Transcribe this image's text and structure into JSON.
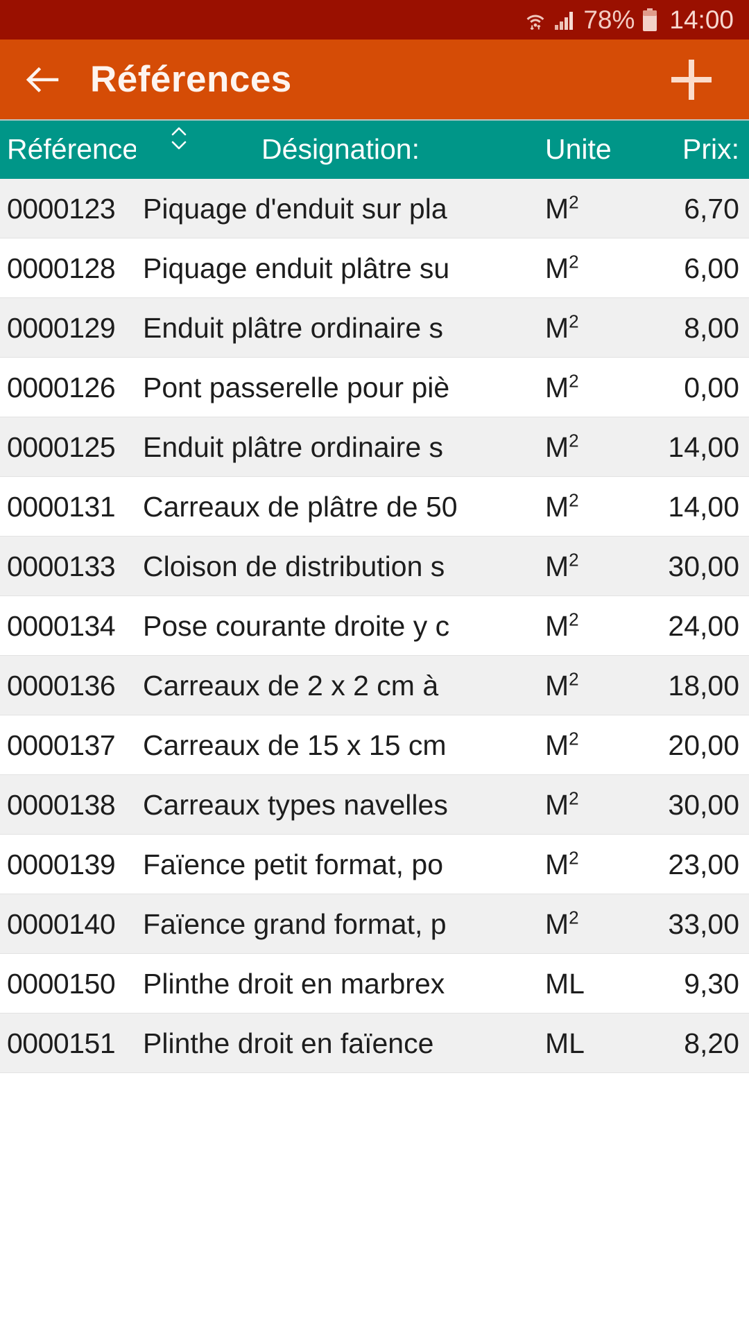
{
  "status_bar": {
    "battery_percent": "78%",
    "clock": "14:00",
    "icons": [
      "wifi-icon",
      "signal-icon",
      "battery-icon"
    ],
    "background_color": "#9a1000"
  },
  "app_bar": {
    "back_icon": "back-arrow-icon",
    "title": "Références",
    "add_icon": "plus-icon",
    "background_color": "#d54c06"
  },
  "table": {
    "header_color": "#009688",
    "sort_indicator_icon": "sort-updown-icon",
    "columns": [
      {
        "key": "reference",
        "label": "Référence:"
      },
      {
        "key": "designation",
        "label": "Désignation:"
      },
      {
        "key": "unite",
        "label": "Unite"
      },
      {
        "key": "prix",
        "label": "Prix:"
      }
    ],
    "rows": [
      {
        "reference": "0000123",
        "designation": "Piquage d'enduit sur pla",
        "unite": "M²",
        "prix": "6,70"
      },
      {
        "reference": "0000128",
        "designation": "Piquage enduit plâtre su",
        "unite": "M²",
        "prix": "6,00"
      },
      {
        "reference": "0000129",
        "designation": "Enduit plâtre ordinaire s",
        "unite": "M²",
        "prix": "8,00"
      },
      {
        "reference": "0000126",
        "designation": "Pont passerelle pour piè",
        "unite": "M²",
        "prix": "0,00"
      },
      {
        "reference": "0000125",
        "designation": "Enduit plâtre ordinaire s",
        "unite": "M²",
        "prix": "14,00"
      },
      {
        "reference": "0000131",
        "designation": "Carreaux de plâtre de 50",
        "unite": "M²",
        "prix": "14,00"
      },
      {
        "reference": "0000133",
        "designation": "Cloison de distribution s",
        "unite": "M²",
        "prix": "30,00"
      },
      {
        "reference": "0000134",
        "designation": "Pose courante droite y c",
        "unite": "M²",
        "prix": "24,00"
      },
      {
        "reference": "0000136",
        "designation": "Carreaux de 2 x 2 cm à ",
        "unite": "M²",
        "prix": "18,00"
      },
      {
        "reference": "0000137",
        "designation": "Carreaux de 15 x 15 cm",
        "unite": "M²",
        "prix": "20,00"
      },
      {
        "reference": "0000138",
        "designation": "Carreaux types navelles",
        "unite": "M²",
        "prix": "30,00"
      },
      {
        "reference": "0000139",
        "designation": "Faïence petit format, po",
        "unite": "M²",
        "prix": "23,00"
      },
      {
        "reference": "0000140",
        "designation": "Faïence grand format, p",
        "unite": "M²",
        "prix": "33,00"
      },
      {
        "reference": "0000150",
        "designation": "Plinthe droit en marbrex",
        "unite": "ML",
        "prix": "9,30"
      },
      {
        "reference": "0000151",
        "designation": "Plinthe droit en faïence",
        "unite": "ML",
        "prix": "8,20"
      }
    ]
  }
}
